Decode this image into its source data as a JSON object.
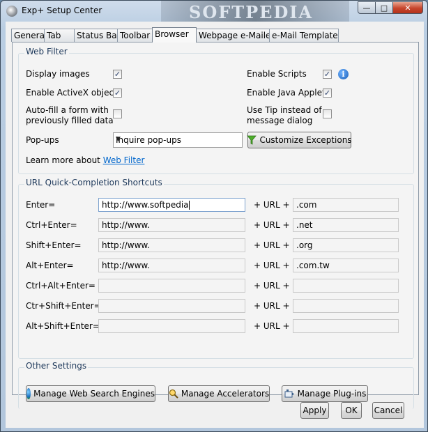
{
  "window": {
    "title": "Exp+ Setup Center",
    "watermark": "SOFTPEDIA"
  },
  "tabs": [
    {
      "label": "General"
    },
    {
      "label": "Tab"
    },
    {
      "label": "Status Bar"
    },
    {
      "label": "Toolbar"
    },
    {
      "label": "Browser"
    },
    {
      "label": "Webpage e-Mailer"
    },
    {
      "label": "e-Mail Template"
    }
  ],
  "web_filter": {
    "title": "Web Filter",
    "display_images": {
      "label": "Display images",
      "checked": true
    },
    "enable_activex": {
      "label": "Enable ActiveX objects",
      "checked": true
    },
    "autofill_line1": "Auto-fill a form with",
    "autofill_line2": "previously filled data",
    "autofill_checked": false,
    "enable_scripts": {
      "label": "Enable Scripts",
      "checked": true
    },
    "enable_java": {
      "label": "Enable Java Applets",
      "checked": true
    },
    "use_tip_line1": "Use Tip instead of",
    "use_tip_line2": "message dialog",
    "use_tip_checked": false,
    "popups_label": "Pop-ups",
    "popups_value": "Inquire pop-ups",
    "customize_label": "Customize Exceptions",
    "learn_more_prefix": "Learn more about",
    "learn_more_link": "Web Filter"
  },
  "shortcuts": {
    "title": "URL Quick-Completion Shortcuts",
    "plus_url": "+ URL +",
    "rows": [
      {
        "key": "Enter=",
        "prefix": "http://www.softpedia",
        "suffix": ".com"
      },
      {
        "key": "Ctrl+Enter=",
        "prefix": "http://www.",
        "suffix": ".net"
      },
      {
        "key": "Shift+Enter=",
        "prefix": "http://www.",
        "suffix": ".org"
      },
      {
        "key": "Alt+Enter=",
        "prefix": "http://www.",
        "suffix": ".com.tw"
      },
      {
        "key": "Ctrl+Alt+Enter=",
        "prefix": "",
        "suffix": ""
      },
      {
        "key": "Ctr+Shift+Enter=",
        "prefix": "",
        "suffix": ""
      },
      {
        "key": "Alt+Shift+Enter=",
        "prefix": "",
        "suffix": ""
      }
    ]
  },
  "other": {
    "title": "Other Settings",
    "search_engines": "Manage Web Search Engines",
    "accelerators": "Manage Accelerators",
    "plugins": "Manage Plug-ins"
  },
  "footer": {
    "apply": "Apply",
    "ok": "OK",
    "cancel": "Cancel"
  }
}
